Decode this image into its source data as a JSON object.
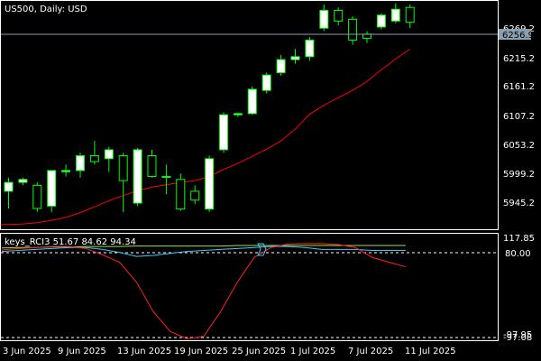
{
  "chart_header": {
    "symbol_label": "US500, Daily:  USD"
  },
  "price_axis": {
    "ticks": [
      "6269.2",
      "6215.2",
      "6161.2",
      "6107.2",
      "6053.2",
      "5999.2",
      "5945.2"
    ],
    "current_price": "6256.9"
  },
  "indicator_panel": {
    "label": "keys_RCI3 51.67 84.62 94.34",
    "axis_ticks": [
      "117.85",
      "80.00",
      "-97.95",
      "-97.08"
    ]
  },
  "time_axis": {
    "labels": [
      "3 Jun 2025",
      "9 Jun 2025",
      "13 Jun 2025",
      "19 Jun 2025",
      "25 Jun 2025",
      "1 Jul 2025",
      "7 Jul 2025",
      "11 Jul 2025"
    ]
  },
  "colors": {
    "background": "#000000",
    "bull_candle_fill": "#ffffff",
    "bear_candle_fill": "#000000",
    "candle_outline": "#00ff00",
    "moving_average": "#ff0000",
    "rci_short": "#ff2020",
    "rci_mid": "#40c8ff",
    "rci_long": "#a0e040",
    "grid_line": "#ffffff",
    "bid_line": "#8aa0b0"
  },
  "chart_data": {
    "type": "candlestick",
    "symbol": "US500",
    "timeframe": "Daily",
    "ylim": [
      5911,
      6296
    ],
    "candles": [
      {
        "o": 5975,
        "h": 5998,
        "l": 5946,
        "c": 5990
      },
      {
        "o": 5990,
        "h": 5998,
        "l": 5985,
        "c": 5995
      },
      {
        "o": 5985,
        "h": 5990,
        "l": 5940,
        "c": 5946
      },
      {
        "o": 5950,
        "h": 6010,
        "l": 5940,
        "c": 6010
      },
      {
        "o": 6008,
        "h": 6020,
        "l": 6000,
        "c": 6010
      },
      {
        "o": 6010,
        "h": 6040,
        "l": 5998,
        "c": 6035
      },
      {
        "o": 6035,
        "h": 6060,
        "l": 6020,
        "c": 6025
      },
      {
        "o": 6030,
        "h": 6050,
        "l": 6008,
        "c": 6045
      },
      {
        "o": 6035,
        "h": 6040,
        "l": 5940,
        "c": 5993
      },
      {
        "o": 5955,
        "h": 6048,
        "l": 5950,
        "c": 6045
      },
      {
        "o": 6035,
        "h": 6045,
        "l": 5998,
        "c": 6000
      },
      {
        "o": 6000,
        "h": 6020,
        "l": 5970,
        "c": 6000
      },
      {
        "o": 5995,
        "h": 6005,
        "l": 5942,
        "c": 5945
      },
      {
        "o": 5975,
        "h": 5985,
        "l": 5953,
        "c": 5960
      },
      {
        "o": 5945,
        "h": 6035,
        "l": 5940,
        "c": 6030
      },
      {
        "o": 6045,
        "h": 6108,
        "l": 6040,
        "c": 6104
      },
      {
        "o": 6104,
        "h": 6108,
        "l": 6100,
        "c": 6106
      },
      {
        "o": 6106,
        "h": 6152,
        "l": 6104,
        "c": 6147
      },
      {
        "o": 6145,
        "h": 6175,
        "l": 6140,
        "c": 6171
      },
      {
        "o": 6175,
        "h": 6205,
        "l": 6170,
        "c": 6197
      },
      {
        "o": 6197,
        "h": 6215,
        "l": 6190,
        "c": 6202
      },
      {
        "o": 6202,
        "h": 6235,
        "l": 6195,
        "c": 6230
      },
      {
        "o": 6250,
        "h": 6290,
        "l": 6245,
        "c": 6280
      },
      {
        "o": 6280,
        "h": 6285,
        "l": 6255,
        "c": 6262
      },
      {
        "o": 6265,
        "h": 6270,
        "l": 6222,
        "c": 6230
      },
      {
        "o": 6240,
        "h": 6245,
        "l": 6225,
        "c": 6233
      },
      {
        "o": 6252,
        "h": 6275,
        "l": 6248,
        "c": 6272
      },
      {
        "o": 6262,
        "h": 6292,
        "l": 6258,
        "c": 6282
      },
      {
        "o": 6285,
        "h": 6290,
        "l": 6250,
        "c": 6260
      }
    ],
    "moving_average": [
      5919,
      5920,
      5922,
      5926,
      5931,
      5939,
      5949,
      5959,
      5968,
      5976,
      5982,
      5986,
      5990,
      5993,
      6000,
      6012,
      6022,
      6034,
      6046,
      6060,
      6080,
      6105,
      6120,
      6133,
      6145,
      6160,
      6180,
      6198,
      6215
    ],
    "indicator": {
      "name": "keys_RCI3",
      "values": [
        51.67,
        84.62,
        94.34
      ],
      "levels": [
        80.0
      ],
      "ylim": [
        -97.95,
        117.85
      ],
      "short": [
        85,
        88,
        90,
        92,
        92,
        88,
        75,
        60,
        20,
        -40,
        -80,
        -95,
        -90,
        -40,
        20,
        70,
        90,
        97,
        98,
        98,
        96,
        90,
        70,
        60,
        51
      ],
      "mid": [
        82,
        84,
        86,
        88,
        90,
        90,
        86,
        80,
        72,
        74,
        78,
        82,
        84,
        86,
        88,
        90,
        92,
        92,
        90,
        86,
        86,
        86,
        84,
        84,
        84
      ],
      "long": [
        89,
        90,
        90,
        91,
        91,
        92,
        92,
        92,
        93,
        93,
        93,
        93,
        93,
        93,
        94,
        94,
        94,
        94,
        94,
        94,
        94,
        94,
        94,
        94,
        94
      ]
    }
  }
}
